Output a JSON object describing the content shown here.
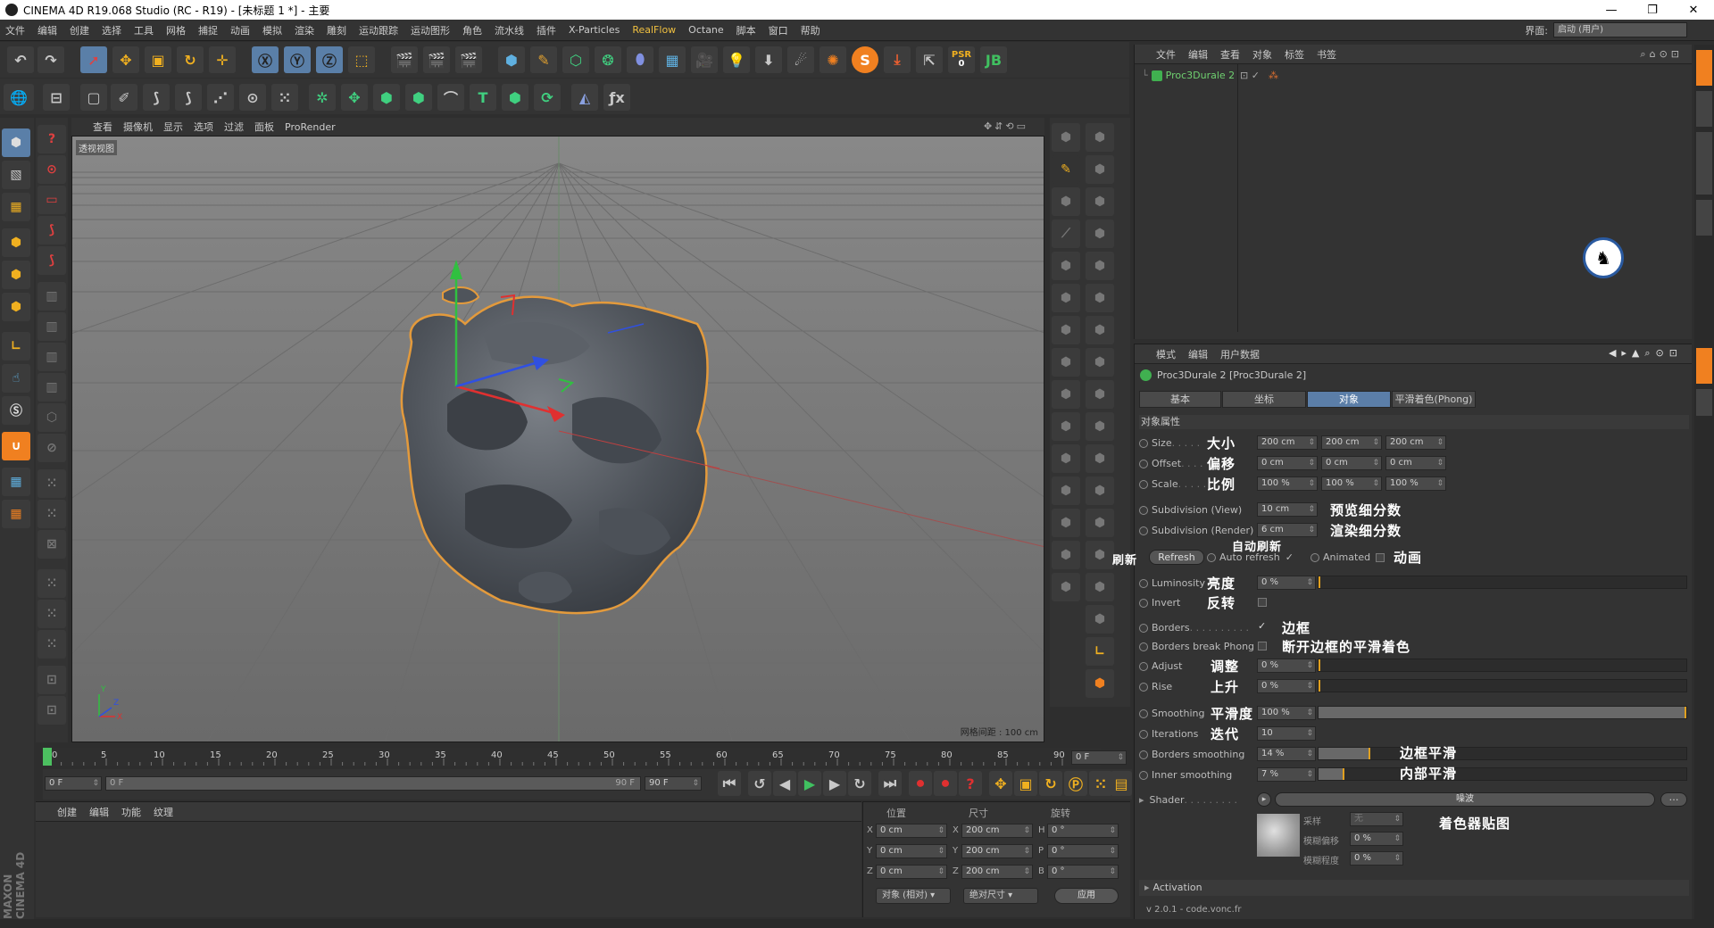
{
  "window": {
    "title": "CINEMA 4D R19.068 Studio (RC - R19) - [未标题 1 *] - 主要",
    "min": "—",
    "max": "❐",
    "close": "✕"
  },
  "menu": [
    "文件",
    "编辑",
    "创建",
    "选择",
    "工具",
    "网格",
    "捕捉",
    "动画",
    "模拟",
    "渲染",
    "雕刻",
    "运动跟踪",
    "运动图形",
    "角色",
    "流水线",
    "插件",
    "X-Particles",
    "RealFlow",
    "Octane",
    "脚本",
    "窗口",
    "帮助"
  ],
  "layout": {
    "label": "界面:",
    "value": "启动 (用户)"
  },
  "viewport": {
    "menu": [
      "查看",
      "摄像机",
      "显示",
      "选项",
      "过滤",
      "面板",
      "ProRender"
    ],
    "name": "透视视图",
    "grid": "网格间距 : 100 cm",
    "axis_y": "Y",
    "axis_z": "Z",
    "axis_x": "X"
  },
  "object_manager": {
    "menu": [
      "文件",
      "编辑",
      "查看",
      "对象",
      "标签",
      "书签"
    ],
    "object": "Proc3Durale 2"
  },
  "attr": {
    "menu": [
      "模式",
      "编辑",
      "用户数据"
    ],
    "title": "Proc3Durale 2 [Proc3Durale 2]",
    "tabs": [
      "基本",
      "坐标",
      "对象",
      "平滑着色(Phong)"
    ],
    "section": "对象属性",
    "size": {
      "label": "Size",
      "cn": "大小",
      "v": [
        "200 cm",
        "200 cm",
        "200 cm"
      ]
    },
    "offset": {
      "label": "Offset",
      "cn": "偏移",
      "v": [
        "0 cm",
        "0 cm",
        "0 cm"
      ]
    },
    "scale": {
      "label": "Scale",
      "cn": "比例",
      "v": [
        "100 %",
        "100 %",
        "100 %"
      ]
    },
    "subview": {
      "label": "Subdivision (View)",
      "value": "10 cm",
      "cn": "预览细分数"
    },
    "subrender": {
      "label": "Subdivision (Render)",
      "value": "6 cm",
      "cn": "渲染细分数"
    },
    "autorefresh_cn": "自动刷新",
    "refresh_cn": "刷新",
    "refresh": "Refresh",
    "autorefresh": "Auto refresh",
    "animated": "Animated",
    "animated_cn": "动画",
    "luminosity": {
      "label": "Luminosity",
      "value": "0 %",
      "cn": "亮度",
      "fill": 0.0
    },
    "invert": {
      "label": "Invert",
      "cn": "反转"
    },
    "borders": {
      "label": "Borders",
      "cn": "边框"
    },
    "bbphong": {
      "label": "Borders break Phong",
      "cn": "断开边框的平滑着色"
    },
    "adjust": {
      "label": "Adjust",
      "value": "0 %",
      "cn": "调整",
      "fill": 0.0
    },
    "rise": {
      "label": "Rise",
      "value": "0 %",
      "cn": "上升",
      "fill": 0.0
    },
    "smoothing": {
      "label": "Smoothing",
      "value": "100 %",
      "cn": "平滑度",
      "fill": 1.0
    },
    "iterations": {
      "label": "Iterations",
      "value": "10",
      "cn": "迭代"
    },
    "bsmooth": {
      "label": "Borders smoothing",
      "value": "14 %",
      "cn": "边框平滑",
      "fill": 0.14
    },
    "ismooth": {
      "label": "Inner smoothing",
      "value": "7 %",
      "cn": "内部平滑",
      "fill": 0.07
    },
    "shader": {
      "label": "Shader",
      "btn": "噪波",
      "cn": "着色器贴图",
      "sample": "采样",
      "sample_v": "无",
      "blur_off": "模糊偏移",
      "blur_off_v": "0 %",
      "blur_str": "模糊程度",
      "blur_str_v": "0 %"
    },
    "activation": "Activation",
    "version": "v 2.0.1 - code.vonc.fr"
  },
  "timeline": {
    "ticks": [
      "0",
      "5",
      "10",
      "15",
      "20",
      "25",
      "30",
      "35",
      "40",
      "45",
      "50",
      "55",
      "60",
      "65",
      "70",
      "75",
      "80",
      "85",
      "90"
    ],
    "current": "0 F",
    "start": "0 F",
    "start2": "0 F",
    "end": "90 F",
    "end2": "90 F"
  },
  "materials": {
    "menu": [
      "创建",
      "编辑",
      "功能",
      "纹理"
    ]
  },
  "coords": {
    "headers": [
      "位置",
      "尺寸",
      "旋转"
    ],
    "rows": [
      {
        "a": "X",
        "p": "0 cm",
        "b": "X",
        "s": "200 cm",
        "c": "H",
        "r": "0 °"
      },
      {
        "a": "Y",
        "p": "0 cm",
        "b": "Y",
        "s": "200 cm",
        "c": "P",
        "r": "0 °"
      },
      {
        "a": "Z",
        "p": "0 cm",
        "b": "Z",
        "s": "200 cm",
        "c": "B",
        "r": "0 °"
      }
    ],
    "mode1": "对象 (相对)",
    "mode2": "绝对尺寸",
    "apply": "应用"
  },
  "brand": "MAXON CINEMA 4D",
  "toolbar": {
    "psr": "PSR",
    "psr_v": "0"
  }
}
